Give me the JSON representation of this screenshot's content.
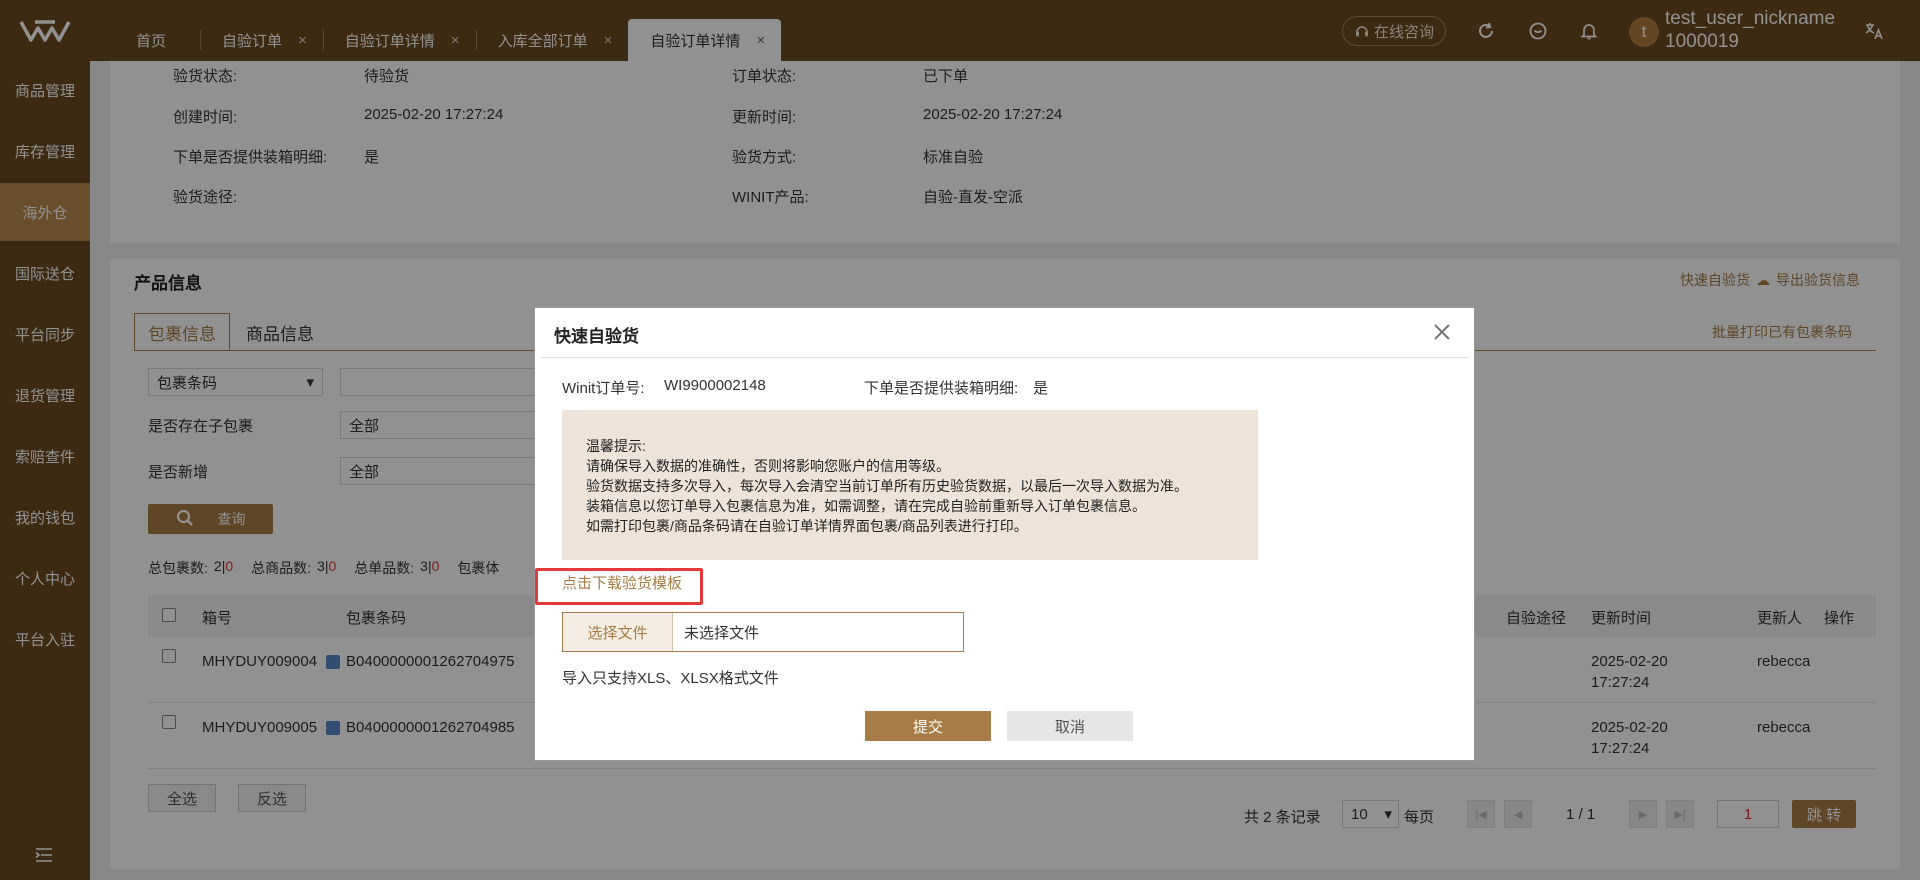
{
  "topbar": {
    "tabs": [
      {
        "label": "首页"
      },
      {
        "label": "自验订单"
      },
      {
        "label": "自验订单详情"
      },
      {
        "label": "入库全部订单"
      },
      {
        "label": "自验订单详情"
      }
    ],
    "close_glyph": "×",
    "consult_label": "在线咨询",
    "user_initial": "t",
    "user_name": "test_user_nickname",
    "user_id": "1000019"
  },
  "sidebar": {
    "items": [
      {
        "label": "商品管理"
      },
      {
        "label": "库存管理"
      },
      {
        "label": "海外仓"
      },
      {
        "label": "国际送仓"
      },
      {
        "label": "平台同步"
      },
      {
        "label": "退货管理"
      },
      {
        "label": "索赔查件"
      },
      {
        "label": "我的钱包"
      },
      {
        "label": "个人中心"
      },
      {
        "label": "平台入驻"
      }
    ]
  },
  "order_info": {
    "rows": [
      {
        "l1": "验货状态:",
        "v1": "待验货",
        "l2": "订单状态:",
        "v2": "已下单"
      },
      {
        "l1": "创建时间:",
        "v1": "2025-02-20 17:27:24",
        "l2": "更新时间:",
        "v2": "2025-02-20 17:27:24"
      },
      {
        "l1": "下单是否提供装箱明细:",
        "v1": "是",
        "l2": "验货方式:",
        "v2": "标准自验"
      },
      {
        "l1": "验货途径:",
        "v1": "",
        "l2": "WINIT产品:",
        "v2": "自验-直发-空派"
      }
    ]
  },
  "product": {
    "title": "产品信息",
    "quick_inspect": "快速自验货",
    "export": "导出验货信息",
    "batch_print": "批量打印已有包裹条码",
    "tabs": [
      "包裹信息",
      "商品信息"
    ],
    "filter_select": "包裹条码",
    "sub_pkg_label": "是否存在子包裹",
    "sub_pkg_value": "全部",
    "new_label": "是否新增",
    "new_value": "全部",
    "query": "查询",
    "stats": {
      "pkg_label": "总包裹数:",
      "pkg_a": "2",
      "pkg_b": "0",
      "goods_label": "总商品数:",
      "goods_a": "3",
      "goods_b": "0",
      "single_label": "总单品数:",
      "single_a": "3",
      "single_b": "0",
      "vol_label": "包裹体"
    },
    "columns": {
      "box": "箱号",
      "barcode": "包裹条码",
      "route": "自验途径",
      "updated": "更新时间",
      "updater": "更新人",
      "ops": "操作"
    },
    "rows": [
      {
        "box": "MHYDUY009004",
        "barcode": "B0400000001262704975",
        "date": "2025-02-20",
        "time": "17:27:24",
        "updater": "rebecca"
      },
      {
        "box": "MHYDUY009005",
        "barcode": "B0400000001262704985",
        "date": "2025-02-20",
        "time": "17:27:24",
        "updater": "rebecca"
      }
    ],
    "select_all": "全选",
    "invert": "反选",
    "pager": {
      "total": "共 2 条记录",
      "per_page_value": "10",
      "per_page_label": "每页",
      "page_info": "1 / 1",
      "page_input": "1",
      "jump": "跳 转"
    }
  },
  "modal": {
    "title": "快速自验货",
    "order_label": "Winit订单号:",
    "order_value": "WI9900002148",
    "detail_label": "下单是否提供装箱明细:",
    "detail_value": "是",
    "tip_lines": [
      "温馨提示:",
      "请确保导入数据的准确性，否则将影响您账户的信用等级。",
      "验货数据支持多次导入，每次导入会清空当前订单所有历史验货数据，以最后一次导入数据为准。",
      "装箱信息以您订单导入包裹信息为准，如需调整，请在完成自验前重新导入订单包裹信息。",
      "如需打印包裹/商品条码请在自验订单详情界面包裹/商品列表进行打印。"
    ],
    "download_link": "点击下载验货模板",
    "choose_file": "选择文件",
    "no_file": "未选择文件",
    "format_hint": "导入只支持XLS、XLSX格式文件",
    "submit": "提交",
    "cancel": "取消"
  },
  "colors": {
    "brand_dark": "#6a4a22",
    "brand_accent": "#a77c46",
    "sidebar_active": "#b8894d",
    "highlight_red": "#e23a3a"
  }
}
